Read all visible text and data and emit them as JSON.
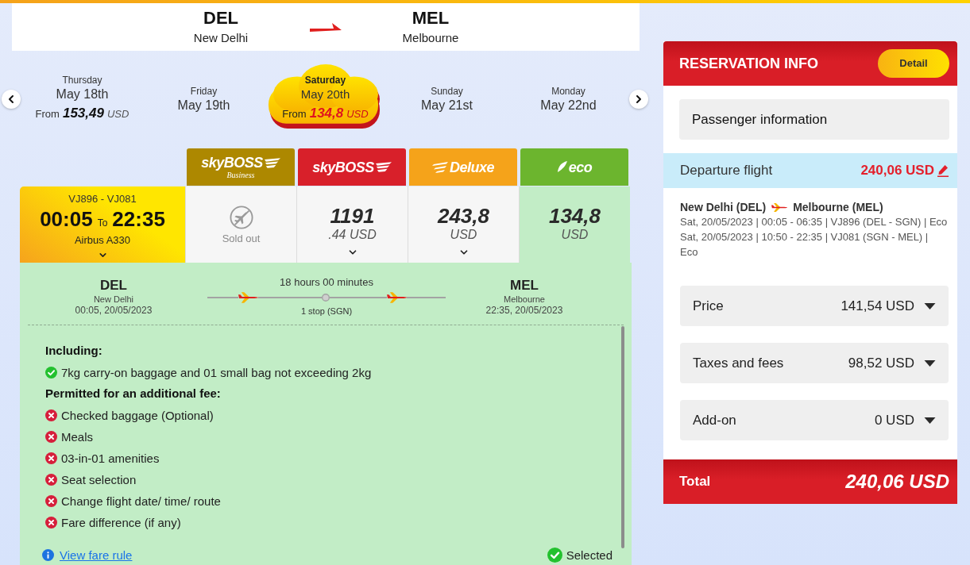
{
  "route_header": {
    "origin": {
      "code": "DEL",
      "city": "New Delhi"
    },
    "destination": {
      "code": "MEL",
      "city": "Melbourne"
    }
  },
  "date_selector": {
    "days": [
      {
        "weekday": "Thursday",
        "date": "May 18th",
        "from_label": "From",
        "price": "153,49",
        "currency": "USD",
        "selected": false
      },
      {
        "weekday": "Friday",
        "date": "May 19th",
        "selected": false
      },
      {
        "weekday": "Saturday",
        "date": "May 20th",
        "from_label": "From",
        "price": "134,8",
        "currency": "USD",
        "selected": true
      },
      {
        "weekday": "Sunday",
        "date": "May 21st",
        "selected": false
      },
      {
        "weekday": "Monday",
        "date": "May 22nd",
        "selected": false
      }
    ]
  },
  "fare_classes": [
    {
      "kind": "business",
      "name": "skyBOSS",
      "subtitle": "Business"
    },
    {
      "kind": "skyboss",
      "name": "skyBOSS"
    },
    {
      "kind": "deluxe",
      "name": "Deluxe"
    },
    {
      "kind": "eco",
      "name": "eco"
    }
  ],
  "flight": {
    "flight_numbers": "VJ896 - VJ081",
    "departure_time": "00:05",
    "to_label": "To",
    "arrival_time": "22:35",
    "aircraft": "Airbus A330",
    "fares": [
      {
        "kind": "sold_out",
        "label": "Sold out",
        "selected": false
      },
      {
        "kind": "price",
        "amount": "1191",
        "unit": ".44 USD",
        "selected": false
      },
      {
        "kind": "price",
        "amount": "243,8",
        "unit": "USD",
        "selected": false
      },
      {
        "kind": "price",
        "amount": "134,8",
        "unit": "USD",
        "selected": true
      }
    ]
  },
  "fare_details": {
    "origin": {
      "code": "DEL",
      "city": "New Delhi",
      "datetime": "00:05, 20/05/2023"
    },
    "duration": "18 hours 00 minutes",
    "stops": "1 stop (SGN)",
    "destination": {
      "code": "MEL",
      "city": "Melbourne",
      "datetime": "22:35, 20/05/2023"
    },
    "sections": [
      {
        "heading": "Including:",
        "items": [
          {
            "kind": "included",
            "text": "7kg carry-on baggage and 01 small bag not exceeding 2kg"
          }
        ]
      },
      {
        "heading": "Permitted for an additional fee:",
        "items": [
          {
            "kind": "paid",
            "text": "Checked baggage (Optional)"
          },
          {
            "kind": "paid",
            "text": "Meals"
          },
          {
            "kind": "paid",
            "text": "03-in-01 amenities"
          },
          {
            "kind": "paid",
            "text": "Seat selection"
          },
          {
            "kind": "paid",
            "text": "Change flight date/ time/ route"
          },
          {
            "kind": "paid",
            "text": "Fare difference (if any)"
          }
        ]
      }
    ],
    "fare_rule_link": "View fare rule",
    "status_label": "Selected"
  },
  "reservation": {
    "title": "RESERVATION INFO",
    "detail_button": "Detail",
    "passenger_section": "Passenger information",
    "departure": {
      "label": "Departure flight",
      "amount": "240,06 USD"
    },
    "route": {
      "from": "New Delhi (DEL)",
      "to": "Melbourne (MEL)"
    },
    "segments": [
      "Sat, 20/05/2023 | 00:05 - 06:35 | VJ896 (DEL - SGN) | Eco",
      "Sat, 20/05/2023 | 10:50 - 22:35 | VJ081 (SGN - MEL) | Eco"
    ],
    "charges": [
      {
        "label": "Price",
        "amount": "141,54 USD"
      },
      {
        "label": "Taxes and fees",
        "amount": "98,52 USD"
      },
      {
        "label": "Add-on",
        "amount": "0 USD"
      }
    ],
    "total": {
      "label": "Total",
      "amount": "240,06 USD"
    }
  }
}
